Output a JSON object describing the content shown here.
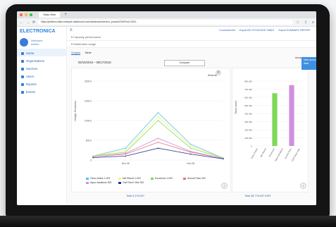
{
  "browser": {
    "tab_title": "Stats Web",
    "tab_plus": "+",
    "url": "https://platform-stats.example-dashboard.com/dashboard/service_product/2049?sd=2018...",
    "nav_back": "←",
    "nav_forward": "→",
    "nav_reload": "⟳",
    "icons": [
      "star-icon",
      "download-icon",
      "menu-icon"
    ]
  },
  "app": {
    "logo": "ELECTRONICA",
    "user_name": "Welcome",
    "user_role": "Admin",
    "sidebar": [
      {
        "label": "Home",
        "icon": "home-icon"
      },
      {
        "label": "Organizations",
        "icon": "org-icon"
      },
      {
        "label": "Services",
        "icon": "services-icon"
      },
      {
        "label": "Users",
        "icon": "users-icon"
      },
      {
        "label": "Reports",
        "icon": "reports-icon"
      },
      {
        "label": "Events",
        "icon": "events-icon"
      }
    ],
    "topbar": {
      "link1": "Connected list",
      "link2": "Export BG STOCKAGE TABLE",
      "link3": "Export SUMMARY REPORT"
    },
    "collapse1": "▾ Capacity performance",
    "collapse2": "▾ Distribution usage",
    "tabs": [
      "Graphs",
      "Table"
    ],
    "date_range": "08/15/2018 – 08/17/2018",
    "compare_label": "Compare",
    "switch_label": "Accumulated",
    "show_all": "Show all",
    "toast": "New account has started updating access data",
    "total_left": "Total 5,178,007",
    "total_right": "Total 38,778,057 EUR",
    "colors": {
      "accent": "#2a66b5",
      "s1": "#4fc3f7",
      "s2": "#fff176",
      "s3": "#7ed957",
      "s4": "#f06292",
      "s5": "#d08fe0",
      "s6": "#1a237e"
    }
  },
  "chart_data": [
    {
      "type": "line",
      "ylabel": "Usage Sessions",
      "x": [
        "",
        "Nov 06",
        "",
        "Nov 08",
        ""
      ],
      "ylim": [
        0,
        2000
      ],
      "yticks": [
        "2000 k",
        "1500 k",
        "1000 k",
        "500 k",
        "0"
      ],
      "series": [
        {
          "name": "Citrus Active",
          "color": "#4fc3f7",
          "values": [
            100,
            300,
            1200,
            400,
            50
          ]
        },
        {
          "name": "Isle Resort",
          "color": "#fff176",
          "values": [
            100,
            250,
            1100,
            350,
            50
          ]
        },
        {
          "name": "Eurotronic",
          "color": "#7ed957",
          "values": [
            100,
            200,
            1000,
            300,
            50
          ]
        },
        {
          "name": "Sunset Pass",
          "color": "#e57373",
          "values": [
            80,
            150,
            450,
            200,
            40
          ]
        },
        {
          "name": "Aqua Vacations",
          "color": "#d08fe0",
          "values": [
            80,
            170,
            550,
            220,
            40
          ]
        },
        {
          "name": "Gulf Pacer Vibe",
          "color": "#283593",
          "values": [
            60,
            100,
            300,
            150,
            30
          ]
        }
      ],
      "legend": [
        {
          "name": "Citrus Active",
          "value": "1,003"
        },
        {
          "name": "Isle Resort",
          "value": "1,003"
        },
        {
          "name": "Eurotronic",
          "value": "1,003"
        },
        {
          "name": "Sunset Pass",
          "value": "302"
        },
        {
          "name": "Aqua Vacations",
          "value": "305"
        },
        {
          "name": "Gulf Pacer Vibe",
          "value": "302"
        }
      ]
    },
    {
      "type": "bar",
      "ylabel": "Total users",
      "categories": [
        "Citrus Active",
        "Isle Resort",
        "Eurotronic",
        "Aqua Vacations",
        "Sunset Pass",
        "Gulf Pacer Vibe"
      ],
      "values": [
        0,
        0,
        650000,
        0,
        750000,
        0
      ],
      "ylim": [
        0,
        800000
      ],
      "yticks": [
        "800 000",
        "700 000",
        "600 000",
        "500 000",
        "400 000",
        "300 000",
        "200 000",
        "100 000",
        "0"
      ],
      "bar_colors": [
        "#4fc3f7",
        "#fff176",
        "#7ed957",
        "#e57373",
        "#d08fe0",
        "#283593"
      ]
    }
  ]
}
